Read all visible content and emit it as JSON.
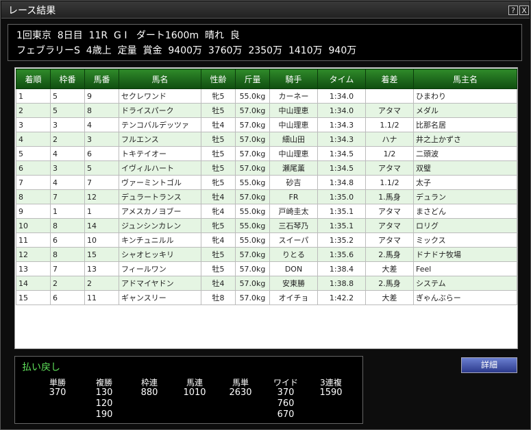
{
  "window": {
    "title": "レース結果",
    "help_label": "?",
    "close_label": "X"
  },
  "race": {
    "line1": "1回東京  8日目  11R  G I   ダート1600m  晴れ  良",
    "line2": "フェブラリーS  4歳上  定量  賞金  9400万  3760万  2350万  1410万  940万"
  },
  "table": {
    "columns": [
      "着順",
      "枠番",
      "馬番",
      "馬名",
      "性齢",
      "斤量",
      "騎手",
      "タイム",
      "着差",
      "馬主名"
    ],
    "rows": [
      [
        "1",
        "5",
        "9",
        "セクレワンド",
        "牝5",
        "55.0kg",
        "カーネー",
        "1:34.0",
        "",
        "ひまわり"
      ],
      [
        "2",
        "5",
        "8",
        "ドライスパーク",
        "牡5",
        "57.0kg",
        "中山理恵",
        "1:34.0",
        "アタマ",
        "メダル"
      ],
      [
        "3",
        "3",
        "4",
        "テンコバルデッツァ",
        "牡4",
        "57.0kg",
        "中山理恵",
        "1:34.3",
        "1.1/2",
        "比那名居"
      ],
      [
        "4",
        "2",
        "3",
        "フルエンス",
        "牡5",
        "57.0kg",
        "細山田",
        "1:34.3",
        "ハナ",
        "井之上かずさ"
      ],
      [
        "5",
        "4",
        "6",
        "トキテイオー",
        "牡5",
        "57.0kg",
        "中山理恵",
        "1:34.5",
        "1/2",
        "二頭波"
      ],
      [
        "6",
        "3",
        "5",
        "イヴィルハート",
        "牡5",
        "57.0kg",
        "瀬尾薫",
        "1:34.5",
        "アタマ",
        "双璧"
      ],
      [
        "7",
        "4",
        "7",
        "ヴァーミントゴル",
        "牝5",
        "55.0kg",
        "砂吉",
        "1:34.8",
        "1.1/2",
        "太子"
      ],
      [
        "8",
        "7",
        "12",
        "デュラートランス",
        "牡4",
        "57.0kg",
        "FR",
        "1:35.0",
        "1.馬身",
        "デュラン"
      ],
      [
        "9",
        "1",
        "1",
        "アメスカノヨブー",
        "牝4",
        "55.0kg",
        "戸崎圭太",
        "1:35.1",
        "アタマ",
        "まさどん"
      ],
      [
        "10",
        "8",
        "14",
        "ジュンシンカレン",
        "牝5",
        "55.0kg",
        "三石琴乃",
        "1:35.1",
        "アタマ",
        "ロリグ"
      ],
      [
        "11",
        "6",
        "10",
        "キンチュニルル",
        "牝4",
        "55.0kg",
        "スイーパ",
        "1:35.2",
        "アタマ",
        "ミックス"
      ],
      [
        "12",
        "8",
        "15",
        "シャオヒッキリ",
        "牡5",
        "57.0kg",
        "りとる",
        "1:35.6",
        "2.馬身",
        "ドナドナ牧場"
      ],
      [
        "13",
        "7",
        "13",
        "フィールワン",
        "牡5",
        "57.0kg",
        "DON",
        "1:38.4",
        "大差",
        "Feel"
      ],
      [
        "14",
        "2",
        "2",
        "アドマイヤドン",
        "牡4",
        "57.0kg",
        "安東勝",
        "1:38.8",
        "2.馬身",
        "システム"
      ],
      [
        "15",
        "6",
        "11",
        "ギャンスリー",
        "牡8",
        "57.0kg",
        "オイチョ",
        "1:42.2",
        "大差",
        "ぎゃんぶらー"
      ]
    ]
  },
  "payout": {
    "title": "払い戻し",
    "columns": [
      {
        "label": "単勝",
        "values": [
          "370"
        ]
      },
      {
        "label": "複勝",
        "values": [
          "130",
          "120",
          "190"
        ]
      },
      {
        "label": "枠連",
        "values": [
          "880"
        ]
      },
      {
        "label": "馬連",
        "values": [
          "1010"
        ]
      },
      {
        "label": "馬単",
        "values": [
          "2630"
        ]
      },
      {
        "label": "ワイド",
        "values": [
          "370",
          "760",
          "670"
        ]
      },
      {
        "label": "3連複",
        "values": [
          "1590"
        ]
      }
    ]
  },
  "detail_button": {
    "label": "詳細"
  }
}
